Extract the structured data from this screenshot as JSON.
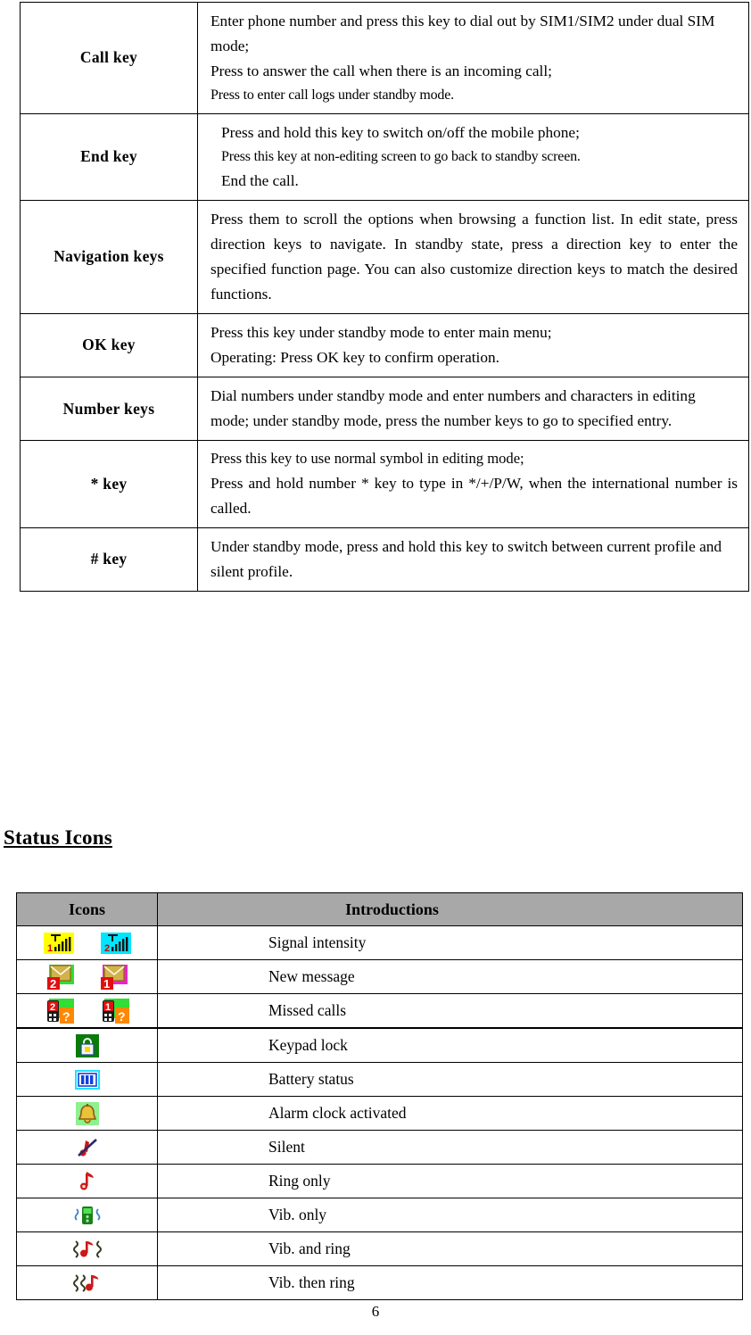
{
  "document": {
    "page_number": "6",
    "section_heading": "Status Icons"
  },
  "keys_table": {
    "rows": [
      {
        "key": "Call    key",
        "lines": [
          "Enter phone number and press this key to dial out by SIM1/SIM2 under dual SIM mode;",
          "Press to answer the call when there is an incoming call;",
          "Press to enter call logs under standby mode."
        ]
      },
      {
        "key": "End key",
        "lines": [
          "Press and hold this key to switch on/off the mobile phone;",
          "Press this key at non-editing screen to go back to standby screen.",
          "End the call."
        ]
      },
      {
        "key": "Navigation keys",
        "lines": [
          "Press them to scroll the options when browsing a function list. In edit state, press direction keys to navigate. In standby state, press a direction key to enter the specified function page. You can also customize direction keys to match the desired functions."
        ]
      },
      {
        "key": "OK key",
        "lines": [
          "Press this key under standby mode to enter main menu;",
          "Operating: Press OK key to confirm operation."
        ]
      },
      {
        "key": "Number keys",
        "lines": [
          "Dial numbers under standby mode and enter numbers and characters in editing mode; under standby mode, press the number keys to go to specified entry."
        ]
      },
      {
        "key": "* key",
        "lines": [
          "Press this key to use normal symbol in editing mode;",
          "Press and hold number * key to type in */+/P/W, when the international number is called."
        ]
      },
      {
        "key": "# key",
        "lines": [
          "Under standby mode, press and hold this key to switch between current profile and silent profile."
        ]
      }
    ]
  },
  "icons_table": {
    "headers": {
      "icons": "Icons",
      "introductions": "Introductions"
    },
    "rows": [
      {
        "icon_name": "signal-intensity-icon",
        "label": "Signal intensity"
      },
      {
        "icon_name": "new-message-icon",
        "label": "New message"
      },
      {
        "icon_name": "missed-calls-icon",
        "label": "Missed calls"
      },
      {
        "icon_name": "keypad-lock-icon",
        "label": "Keypad lock"
      },
      {
        "icon_name": "battery-status-icon",
        "label": "Battery status"
      },
      {
        "icon_name": "alarm-clock-icon",
        "label": "Alarm clock activated"
      },
      {
        "icon_name": "silent-icon",
        "label": "Silent"
      },
      {
        "icon_name": "ring-only-icon",
        "label": "Ring only"
      },
      {
        "icon_name": "vibrate-only-icon",
        "label": "Vib. only"
      },
      {
        "icon_name": "vibrate-and-ring-icon",
        "label": "Vib. and ring"
      },
      {
        "icon_name": "vibrate-then-ring-icon",
        "label": "Vib. then ring"
      }
    ]
  },
  "colors": {
    "header_grey": "#a8a8a8",
    "sim1_yellow": "#ffff00",
    "sim2_cyan": "#00e5ff",
    "envelope_gold": "#d2b24a",
    "badge_red": "#e01010",
    "badge_green": "#33dd33",
    "badge_magenta": "#ee22cc",
    "badge_orange": "#ff8800",
    "lock_green": "#0a7a0a",
    "lock_yellow": "#ffd700",
    "battery_blue": "#1040dd",
    "battery_cyan": "#20e0ff",
    "alarm_gold": "#e8c23a",
    "alarm_green": "#8ef08e",
    "note_red": "#cc1818",
    "vib_dark": "#333322"
  }
}
